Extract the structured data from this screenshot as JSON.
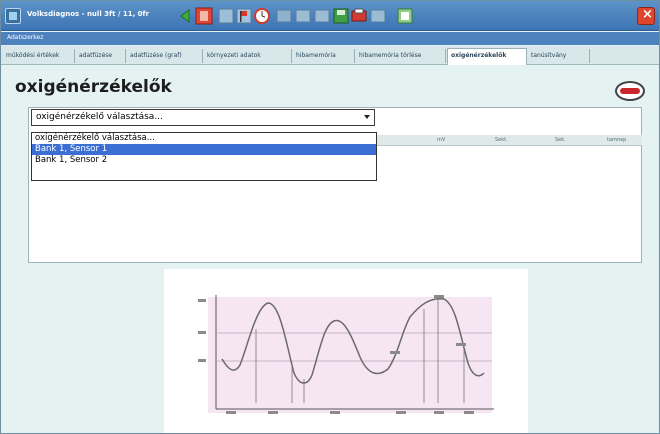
{
  "window": {
    "title": "Volksdiagnos - null 3ft / 11, 0fr",
    "nav_label": "Adatszerkez"
  },
  "tabs": [
    {
      "label": "működési értékek"
    },
    {
      "label": "adatfüzése"
    },
    {
      "label": "adatfüzése (graf)"
    },
    {
      "label": "környezeti adatok"
    },
    {
      "label": "hibamemória"
    },
    {
      "label": "hibamemória törlése"
    },
    {
      "label": "oxigénérzékelők",
      "active": true
    },
    {
      "label": "tanúsítvány"
    }
  ],
  "page": {
    "title": "oxigénérzékelők"
  },
  "sensor_select": {
    "value": "oxigénérzékelő választása...",
    "options": [
      "oxigénérzékelő választása...",
      "Bank 1, Sensor 1",
      "Bank 1, Sensor 2"
    ],
    "highlighted_index": 1
  },
  "table": {
    "headers": [
      "mV",
      "Sekt.",
      "Sek.",
      "tamnep"
    ]
  },
  "colors": {
    "accent": "#3b6fd4",
    "background": "#e4f3f1",
    "chart_bg": "#f6e6f4",
    "curve": "#6a6a6a"
  }
}
